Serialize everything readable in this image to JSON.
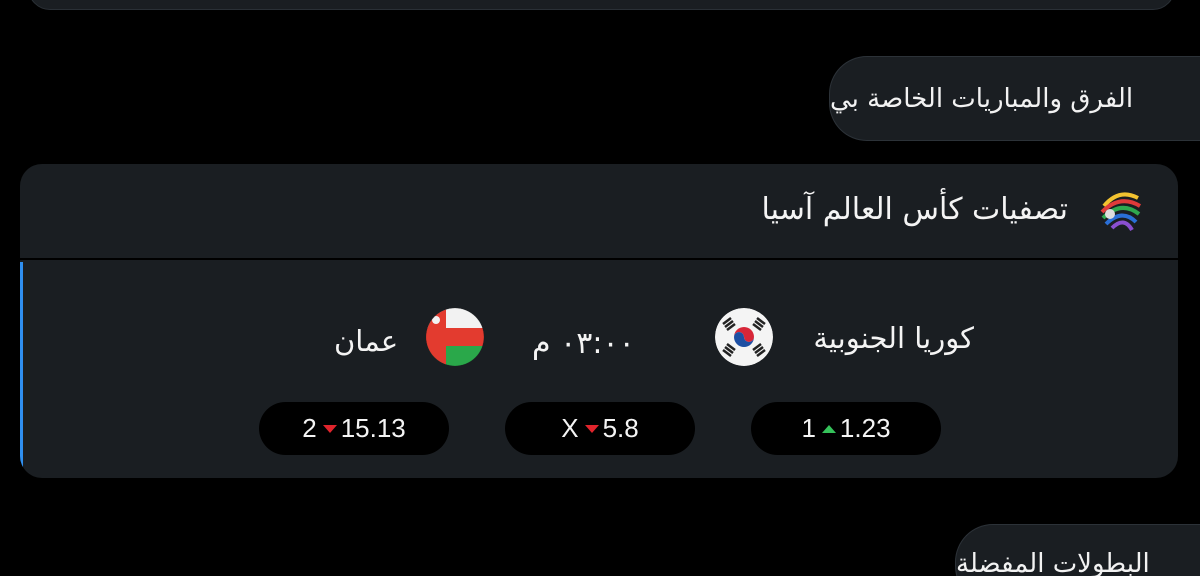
{
  "sections": {
    "teams_and_matches": "الفرق والمباريات الخاصة بي",
    "favorite_leagues": "البطولات المفضلة"
  },
  "league": {
    "name": "تصفيات كأس العالم آسيا",
    "logo_icon": "afc-logo-icon"
  },
  "match": {
    "home_team": "كوريا الجنوبية",
    "home_flag_icon": "south-korea-flag-icon",
    "away_team": "عمان",
    "away_flag_icon": "oman-flag-icon",
    "time": "٠٣:٠٠ م"
  },
  "odds": {
    "home": {
      "label": "1",
      "value": "1.23",
      "trend": "up",
      "trend_icon": "arrow-up-icon"
    },
    "draw": {
      "label": "X",
      "value": "5.8",
      "trend": "down",
      "trend_icon": "arrow-down-icon"
    },
    "away": {
      "label": "2",
      "value": "15.13",
      "trend": "down",
      "trend_icon": "arrow-down-icon"
    }
  },
  "colors": {
    "background": "#000000",
    "card": "#1a1e22",
    "accent": "#2f8ff0",
    "trend_up": "#35c25a",
    "trend_down": "#e0242c"
  }
}
